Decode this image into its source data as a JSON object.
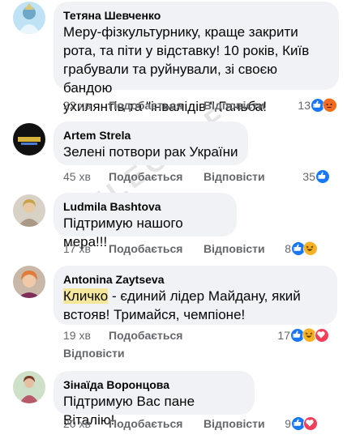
{
  "comments": [
    {
      "author": "Тетяна Шевченко",
      "lines": [
        "Меру-фізкультурнику, краще закрити",
        "рота, та піти у відставку! 10 років, Київ",
        "грабували та руйнували, зі своєю бандою",
        "ухилянтів та \"інвалідів \" Ганьба!"
      ],
      "time": "22 хв",
      "like": "Подобається",
      "reply": "Відповісти",
      "reactions_count": "13",
      "reactions": [
        "like-icon",
        "angry-icon"
      ]
    },
    {
      "author": "Artem Strela",
      "lines": [
        "Зелені потвори рак України"
      ],
      "time": "45 хв",
      "like": "Подобається",
      "reply": "Відповісти",
      "reactions_count": "35",
      "reactions": [
        "like-icon"
      ]
    },
    {
      "author": "Ludmila Bashtova",
      "lines": [
        "Підтримую нашого мера!!!"
      ],
      "time": "17 хв",
      "like": "Подобається",
      "reply": "Відповісти",
      "reactions_count": "8",
      "reactions": [
        "like-icon",
        "haha-icon"
      ]
    },
    {
      "author": "Antonina Zaytseva",
      "lines": [
        "Кличко - єдиний лідер Майдану, який",
        "встояв! Тримайся, чемпіоне!"
      ],
      "time": "19 хв",
      "like": "Подобається",
      "reply": "Відповісти",
      "reactions_count": "17",
      "reactions": [
        "like-icon",
        "haha-icon",
        "love-icon"
      ]
    },
    {
      "author": "Зінаїда Воронцова",
      "lines": [
        "Підтримую Вас пане Віталію!"
      ],
      "time": "20 хв",
      "like": "Подобається",
      "reply": "Відповісти",
      "reactions_count": "9",
      "reactions": [
        "like-icon",
        "love-icon"
      ]
    }
  ],
  "watermark": "TELEGRAF",
  "colors": {
    "bubble": "#f0f2f5",
    "meta": "#65676b",
    "like": "#1877f2",
    "angry": "#e9710f",
    "haha": "#f7b125",
    "love": "#f33e58"
  }
}
